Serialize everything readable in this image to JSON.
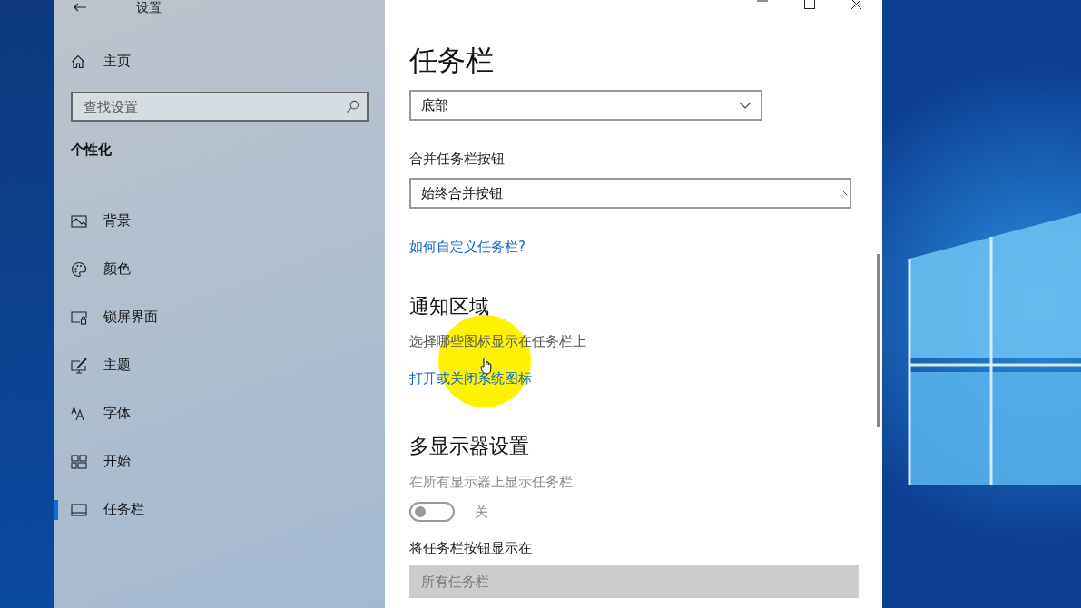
{
  "window": {
    "title": "设置"
  },
  "sidebar": {
    "home": "主页",
    "search": {
      "placeholder": "查找设置"
    },
    "section": "个性化",
    "items": [
      {
        "label": "背景",
        "selected": false
      },
      {
        "label": "颜色",
        "selected": false
      },
      {
        "label": "锁屏界面",
        "selected": false
      },
      {
        "label": "主题",
        "selected": false
      },
      {
        "label": "字体",
        "selected": false
      },
      {
        "label": "开始",
        "selected": false
      },
      {
        "label": "任务栏",
        "selected": true
      }
    ]
  },
  "content": {
    "title": "任务栏",
    "position_dropdown": {
      "value": "底部",
      "disabled": false
    },
    "combine": {
      "label": "合并任务栏按钮",
      "dropdown": {
        "value": "始终合并按钮",
        "disabled": false
      }
    },
    "help_link": "如何自定义任务栏?",
    "notification": {
      "heading": "通知区域",
      "text": "选择哪些图标显示在任务栏上",
      "link": "打开或关闭系统图标"
    },
    "multi_display": {
      "heading": "多显示器设置",
      "show_all": {
        "label": "在所有显示器上显示任务栏",
        "on": false,
        "state_text": "关",
        "disabled": true
      },
      "buttons_on": {
        "label": "将任务栏按钮显示在",
        "dropdown": {
          "value": "所有任务栏",
          "disabled": true
        }
      }
    }
  }
}
